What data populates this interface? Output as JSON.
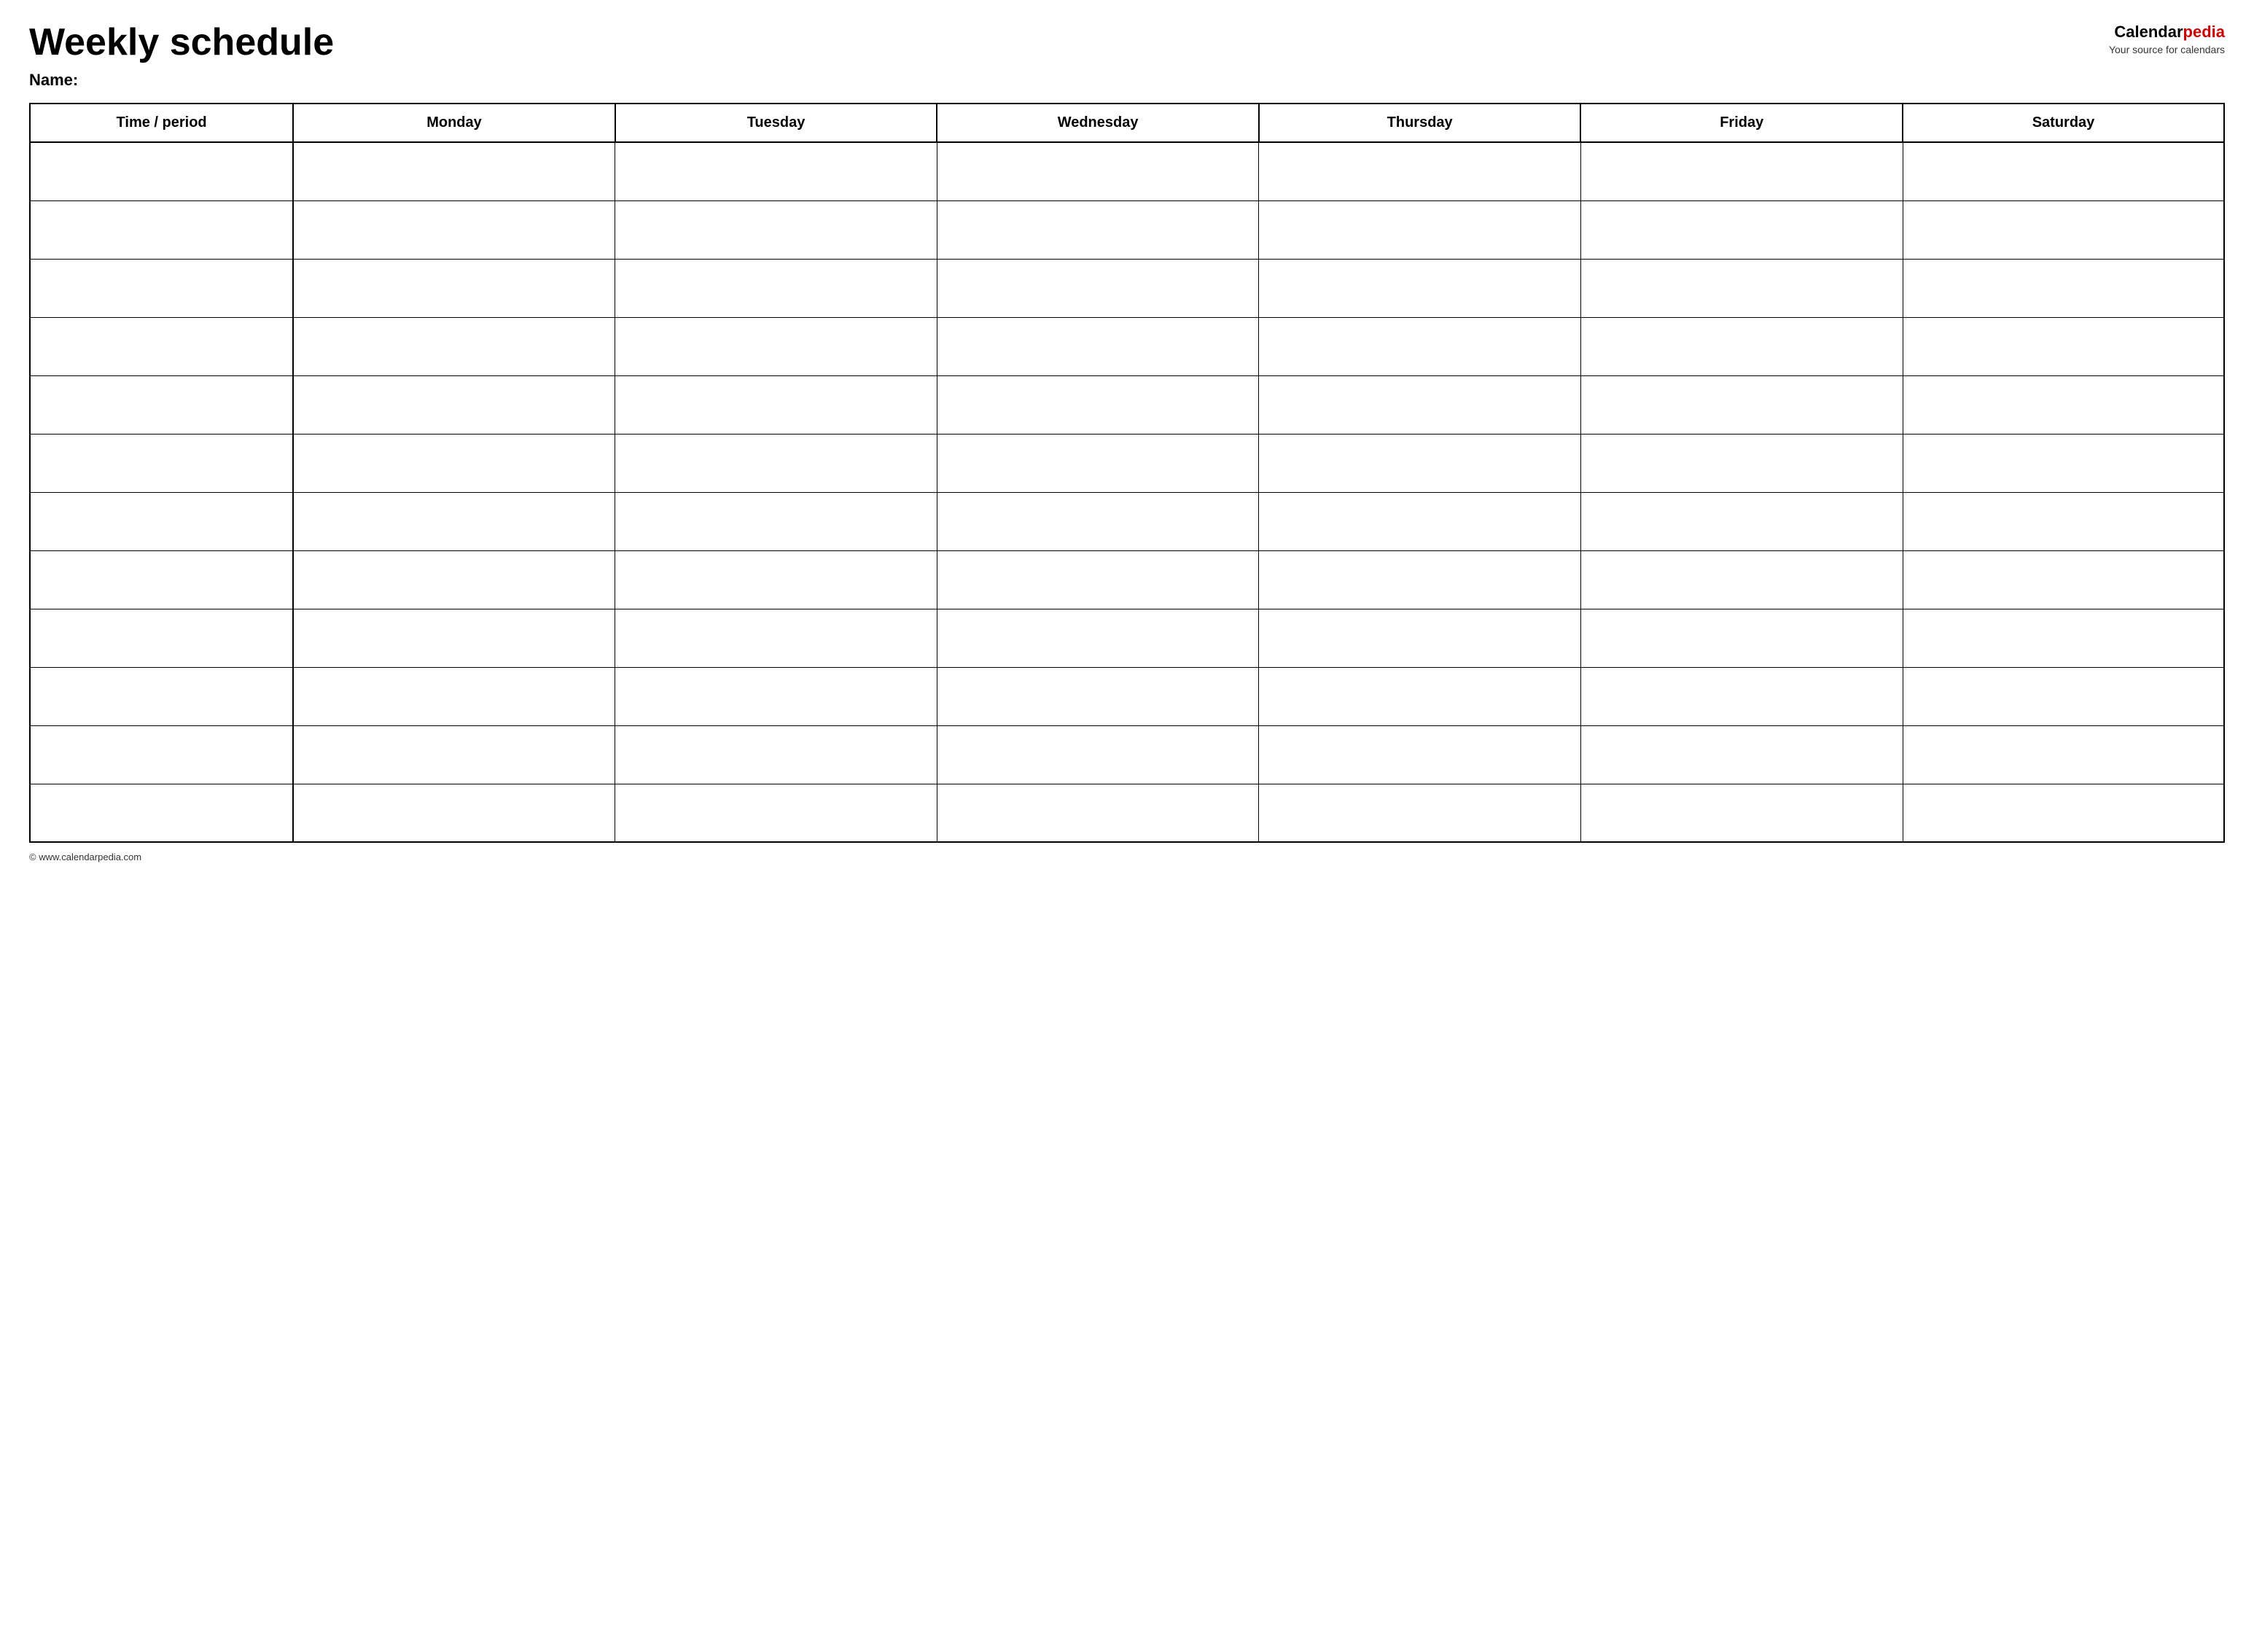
{
  "header": {
    "title": "Weekly schedule",
    "name_label": "Name:",
    "logo": {
      "calendar": "Calendar",
      "pedia": "pedia",
      "tagline": "Your source for calendars"
    }
  },
  "table": {
    "columns": [
      {
        "id": "time",
        "label": "Time / period"
      },
      {
        "id": "monday",
        "label": "Monday"
      },
      {
        "id": "tuesday",
        "label": "Tuesday"
      },
      {
        "id": "wednesday",
        "label": "Wednesday"
      },
      {
        "id": "thursday",
        "label": "Thursday"
      },
      {
        "id": "friday",
        "label": "Friday"
      },
      {
        "id": "saturday",
        "label": "Saturday"
      }
    ],
    "row_count": 12
  },
  "footer": {
    "url": "© www.calendarpedia.com"
  }
}
